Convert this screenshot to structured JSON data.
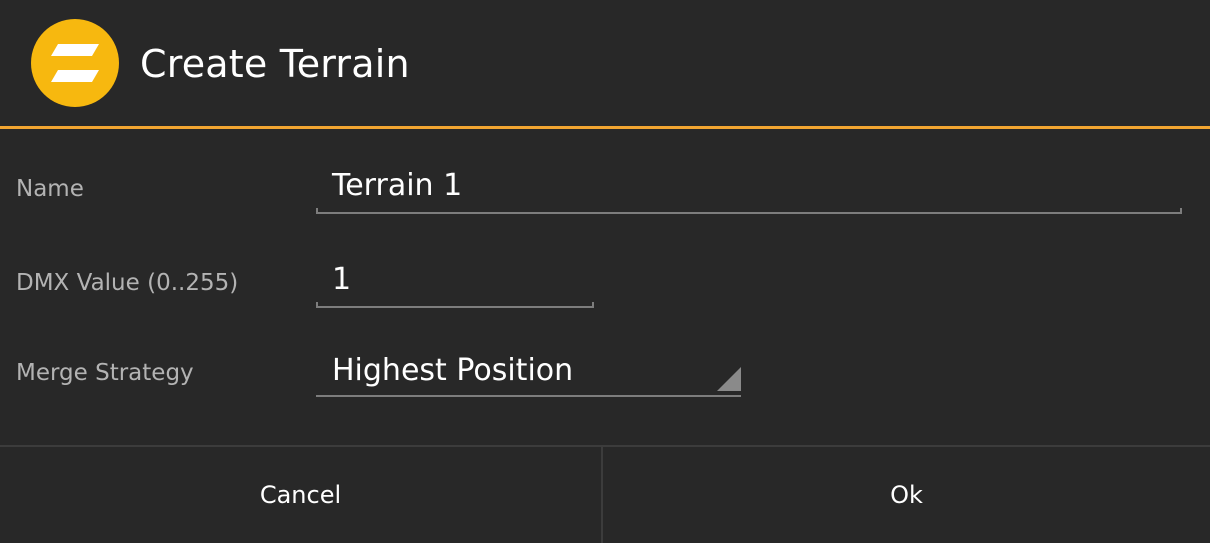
{
  "dialog": {
    "title": "Create Terrain",
    "logo_icon": "terrain-logo-icon",
    "accent_color": "#f2a531",
    "logo_color": "#f7b80f"
  },
  "form": {
    "name": {
      "label": "Name",
      "value": "Terrain 1"
    },
    "dmx": {
      "label": "DMX Value (0..255)",
      "value": "1"
    },
    "merge": {
      "label": "Merge Strategy",
      "selected": "Highest Position"
    }
  },
  "buttons": {
    "cancel_label": "Cancel",
    "ok_label": "Ok"
  }
}
